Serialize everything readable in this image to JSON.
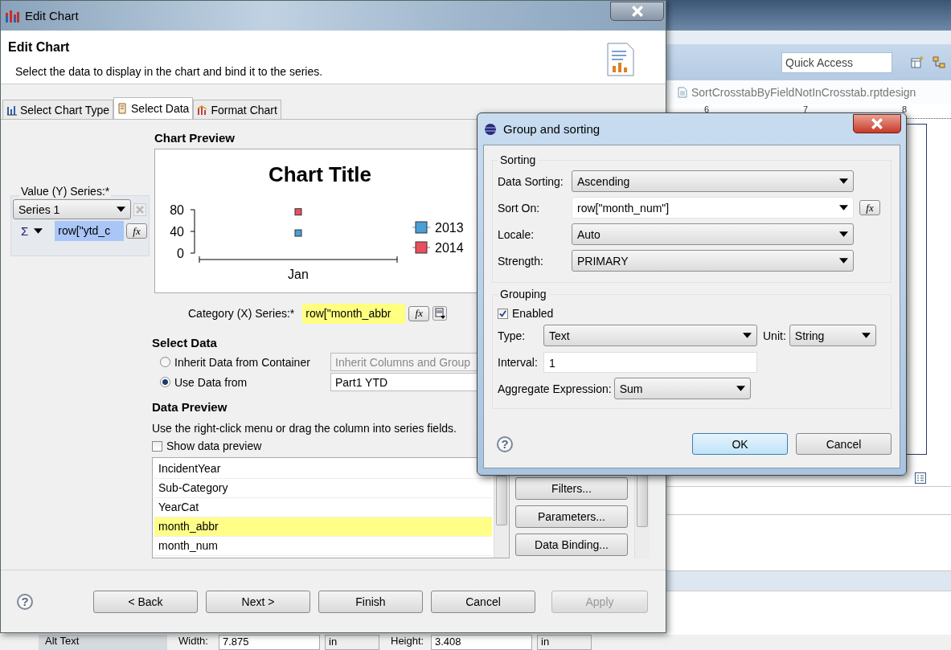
{
  "ide": {
    "quick_access": {
      "placeholder": "Quick Access"
    },
    "editor_tab": "SortCrosstabByFieldNotInCrosstab.rptdesign",
    "ruler_labels": [
      "6",
      "7",
      "8"
    ],
    "properties": {
      "list_item": "Alt Text",
      "width_label": "Width:",
      "width_value": "7.875",
      "width_unit": "in",
      "height_label": "Height:",
      "height_value": "3.408",
      "height_unit": "in"
    }
  },
  "edit_chart": {
    "title": "Edit Chart",
    "heading": "Edit Chart",
    "description": "Select the data to display in the chart and bind it to the series.",
    "tabs": [
      {
        "label": "Select Chart Type",
        "selected": false,
        "kind": "chart-type"
      },
      {
        "label": "Select Data",
        "selected": true,
        "kind": "data"
      },
      {
        "label": "Format Chart",
        "selected": false,
        "kind": "format"
      }
    ],
    "chart_preview": {
      "heading": "Chart Preview",
      "chart_data": {
        "type": "scatter",
        "title": "Chart Title",
        "legend": "right",
        "categories": [
          "Jan"
        ],
        "ylim": [
          0,
          80
        ],
        "yticks": [
          0,
          40,
          80
        ],
        "series": [
          {
            "name": "2013",
            "color": "#4a9fd8",
            "values": [
              37
            ]
          },
          {
            "name": "2014",
            "color": "#e8505f",
            "values": [
              76
            ]
          }
        ]
      }
    },
    "value_series": {
      "label": "Value (Y) Series:*",
      "series_select": "Series 1",
      "aggregate_symbol": "Σ",
      "expression": "row[\"ytd_c",
      "function_button": "fx"
    },
    "category_series": {
      "label": "Category (X) Series:*",
      "expression": "row[\"month_abbr",
      "function_button": "fx"
    },
    "select_data": {
      "heading": "Select Data",
      "options": [
        {
          "label": "Inherit Data from Container",
          "selected": false,
          "value": "Inherit Columns and Group",
          "disabled": true
        },
        {
          "label": "Use Data from",
          "selected": true,
          "value": "Part1 YTD",
          "disabled": false
        }
      ]
    },
    "data_preview": {
      "heading": "Data Preview",
      "hint": "Use the right-click menu or drag the column into series fields.",
      "show_preview": {
        "label": "Show data preview",
        "checked": false
      },
      "columns": [
        {
          "label": "IncidentYear",
          "selected": false
        },
        {
          "label": "Sub-Category",
          "selected": false
        },
        {
          "label": "YearCat",
          "selected": false
        },
        {
          "label": "month_abbr",
          "selected": true
        },
        {
          "label": "month_num",
          "selected": false
        }
      ],
      "buttons": [
        "Filters...",
        "Parameters...",
        "Data Binding..."
      ]
    },
    "help": "?",
    "buttons": [
      {
        "label": "< Back",
        "disabled": false
      },
      {
        "label": "Next >",
        "disabled": false
      },
      {
        "label": "Finish",
        "disabled": false
      },
      {
        "label": "Cancel",
        "disabled": false
      },
      {
        "label": "Apply",
        "disabled": true
      }
    ]
  },
  "group_dialog": {
    "title": "Group and sorting",
    "sorting": {
      "legend": "Sorting",
      "function_button": "fx",
      "rows": [
        {
          "label": "Data Sorting:",
          "value": "Ascending",
          "kind": "dropdown"
        },
        {
          "label": "Sort On:",
          "value": "row[\"month_num\"]",
          "kind": "expression"
        },
        {
          "label": "Locale:",
          "value": "Auto",
          "kind": "dropdown"
        },
        {
          "label": "Strength:",
          "value": "PRIMARY",
          "kind": "dropdown"
        }
      ]
    },
    "grouping": {
      "legend": "Grouping",
      "enabled": {
        "label": "Enabled",
        "checked": true
      },
      "type": {
        "label": "Type:",
        "value": "Text"
      },
      "unit": {
        "label": "Unit:",
        "value": "String"
      },
      "interval": {
        "label": "Interval:",
        "value": "1"
      },
      "aggregate": {
        "label": "Aggregate Expression:",
        "value": "Sum"
      }
    },
    "help": "?",
    "buttons": [
      {
        "label": "OK",
        "default": true
      },
      {
        "label": "Cancel",
        "default": false
      }
    ]
  }
}
